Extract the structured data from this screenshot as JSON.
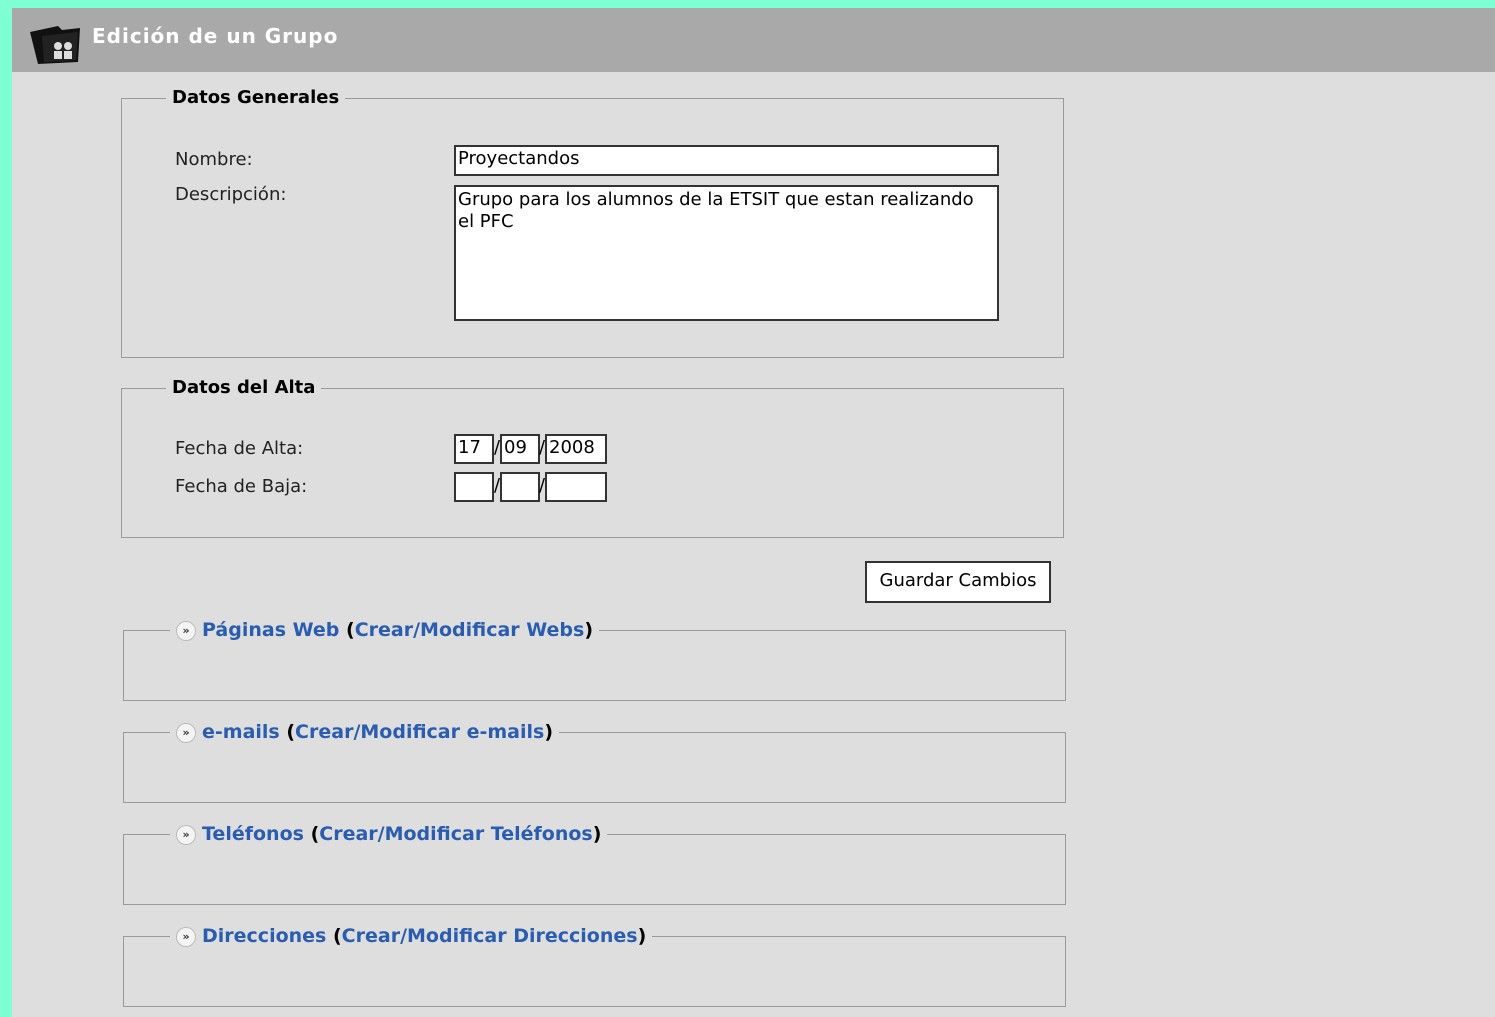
{
  "window": {
    "title": "Edición de un Grupo",
    "icon": "group-folder-icon"
  },
  "datos_generales": {
    "legend": "Datos Generales",
    "nombre_label": "Nombre:",
    "nombre_value": "Proyectandos",
    "descripcion_label": "Descripción:",
    "descripcion_value": "Grupo para los alumnos de la ETSIT que estan realizando el PFC"
  },
  "datos_alta": {
    "legend": "Datos del Alta",
    "alta_label": "Fecha de Alta:",
    "alta_day": "17",
    "alta_month": "09",
    "alta_year": "2008",
    "baja_label": "Fecha de Baja:",
    "baja_day": "",
    "baja_month": "",
    "baja_year": "",
    "separator": "/"
  },
  "save_button": "Guardar Cambios",
  "sections": [
    {
      "title": "Páginas Web",
      "link": "Crear/Modificar Webs"
    },
    {
      "title": "e-mails",
      "link": "Crear/Modificar e-mails"
    },
    {
      "title": "Teléfonos",
      "link": "Crear/Modificar Teléfonos"
    },
    {
      "title": "Direcciones",
      "link": "Crear/Modificar Direcciones"
    }
  ],
  "section_punct": {
    "open": "(",
    "close": ")"
  },
  "colors": {
    "background": "#7fffd4",
    "titlebar": "#a9a9a9",
    "panel": "#dedede",
    "link": "#2a5db0"
  }
}
